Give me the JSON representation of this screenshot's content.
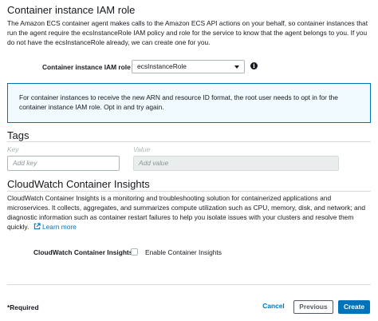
{
  "iam_section": {
    "title": "Container instance IAM role",
    "description": "The Amazon ECS container agent makes calls to the Amazon ECS API actions on your behalf, so container instances that run the agent require the ecsInstanceRole IAM policy and role for the service to know that the agent belongs to you. If you do not have the ecsInstanceRole already, we can create one for you.",
    "role_label": "Container instance IAM role",
    "role_value": "ecsInstanceRole",
    "info_icon": "info-icon"
  },
  "alert": {
    "text": "For container instances to receive the new ARN and resource ID format, the root user needs to opt in for the container instance IAM role. Opt in and try again."
  },
  "tags": {
    "title": "Tags",
    "key_header": "Key",
    "value_header": "Value",
    "key_placeholder": "Add key",
    "value_placeholder": "Add value"
  },
  "insights": {
    "title": "CloudWatch Container Insights",
    "description": "CloudWatch Container Insights is a monitoring and troubleshooting solution for containerized applications and microservices. It collects, aggregates, and summarizes compute utilization such as CPU, memory, disk, and network; and diagnostic information such as container restart failures to help you isolate issues with your clusters and resolve them quickly.",
    "learn_more": "Learn more",
    "field_label": "CloudWatch Container Insights",
    "checkbox_label": "Enable Container Insights",
    "checked": false
  },
  "footer": {
    "required": "*Required",
    "cancel": "Cancel",
    "previous": "Previous",
    "create": "Create"
  },
  "colors": {
    "primary": "#0073bb",
    "alert_bg": "#f1faff"
  }
}
